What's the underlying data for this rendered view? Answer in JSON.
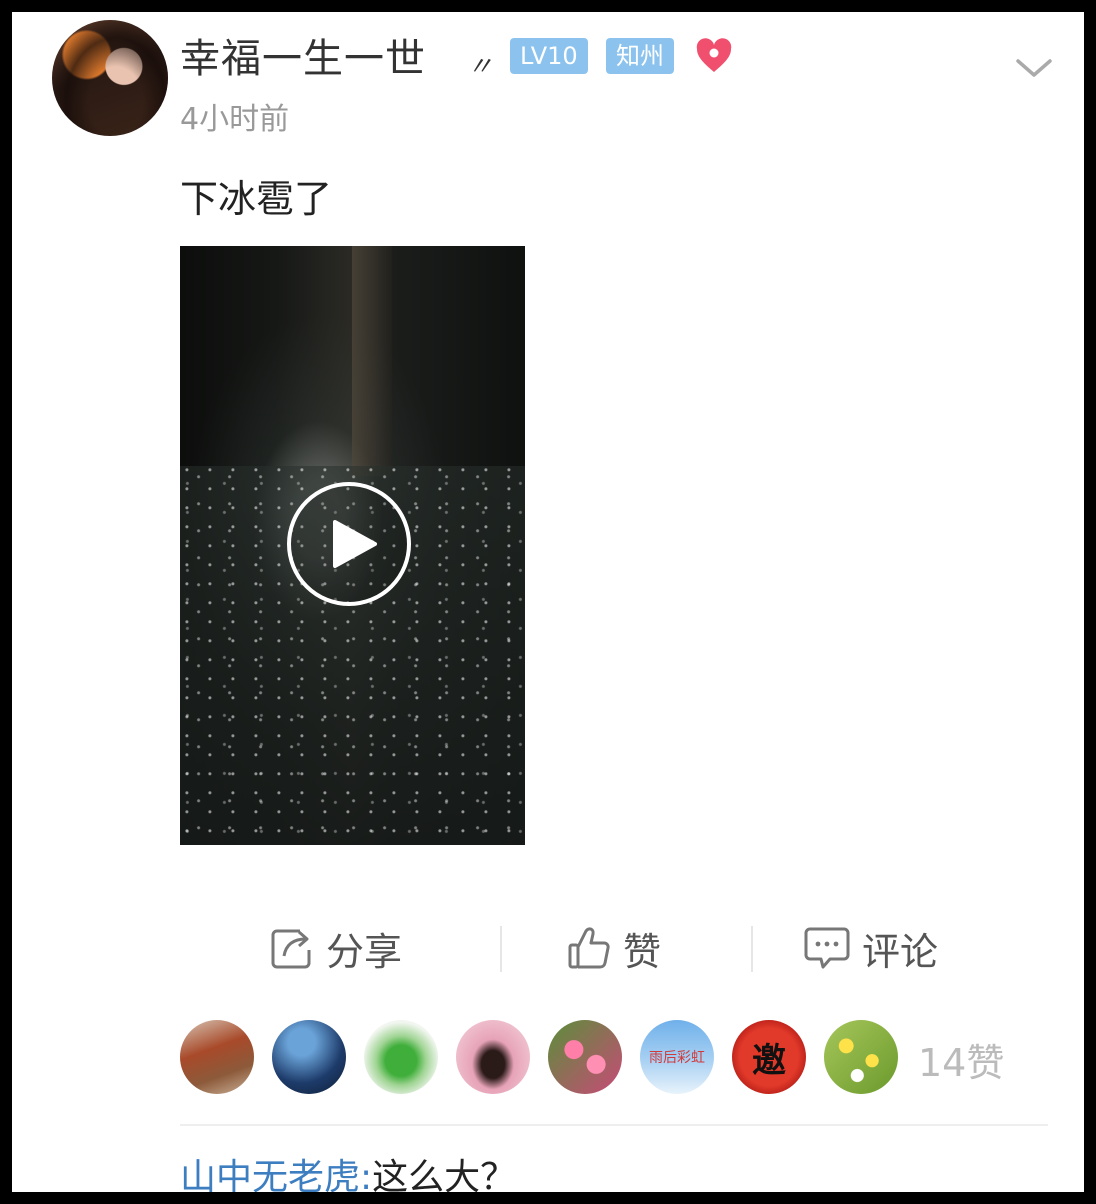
{
  "post": {
    "username": "幸福一生一世",
    "name_decoration": "〃",
    "level_badge": "LV10",
    "location_badge": "知州",
    "time": "4小时前",
    "text": "下冰雹了"
  },
  "icons": {
    "heart": "heart-location-icon",
    "menu": "chevron-down-icon",
    "play": "play-icon",
    "share": "share-icon",
    "like": "thumbs-up-icon",
    "comment": "comment-bubble-icon"
  },
  "actions": {
    "share_label": "分享",
    "like_label": "赞",
    "comment_label": "评论"
  },
  "likes": {
    "count_label": "14赞",
    "avatars": [
      "liker-1",
      "liker-2",
      "liker-3",
      "liker-4",
      "liker-5",
      "liker-6",
      "liker-7",
      "liker-8"
    ],
    "avatar_texts": {
      "rainbow": "雨后彩虹",
      "seal": "邀"
    }
  },
  "comments": [
    {
      "user": "山中无老虎",
      "separator": ":",
      "text": "这么大？"
    }
  ],
  "colors": {
    "badge": "#8cc3ee",
    "heart": "#f0506e",
    "link": "#3d7ec1"
  }
}
